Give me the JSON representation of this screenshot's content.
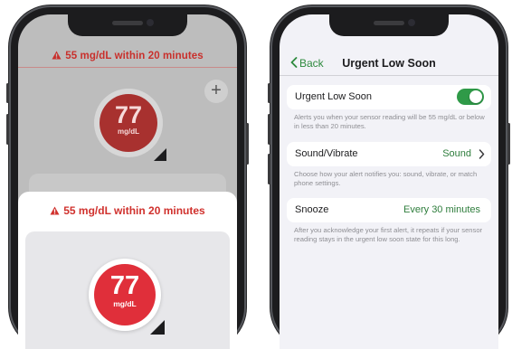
{
  "left_phone": {
    "background_alert": "55 mg/dL within 20 minutes",
    "add_label": "+",
    "background_reading": {
      "value": "77",
      "unit": "mg/dL"
    },
    "alert": "55 mg/dL within 20 minutes",
    "reading": {
      "value": "77",
      "unit": "mg/dL"
    }
  },
  "right_phone": {
    "nav": {
      "back_label": "Back",
      "title": "Urgent Low Soon"
    },
    "urgent_low_soon": {
      "label": "Urgent Low Soon",
      "enabled": true,
      "help": "Alerts you when your sensor reading will be 55 mg/dL or below in less than 20 minutes."
    },
    "sound_vibrate": {
      "label": "Sound/Vibrate",
      "value": "Sound",
      "help": "Choose how your alert notifies you: sound, vibrate, or match phone settings."
    },
    "snooze": {
      "label": "Snooze",
      "value": "Every 30 minutes",
      "help": "After you acknowledge your first alert, it repeats if your sensor reading stays in the urgent low soon state for this long."
    }
  },
  "colors": {
    "alert_red": "#e02f3a",
    "accent_green": "#2e8a3e",
    "toggle_green": "#2f9a48"
  }
}
